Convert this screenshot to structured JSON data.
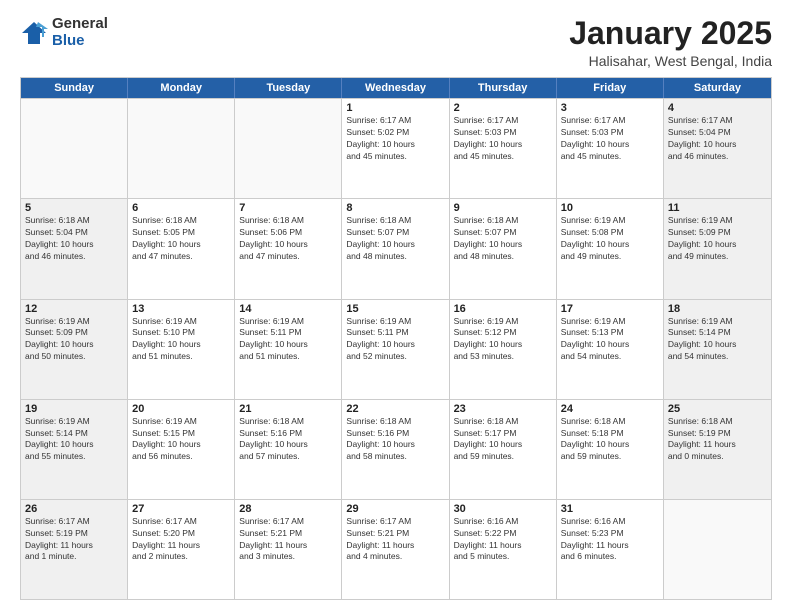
{
  "header": {
    "logo_general": "General",
    "logo_blue": "Blue",
    "month_title": "January 2025",
    "subtitle": "Halisahar, West Bengal, India"
  },
  "weekdays": [
    "Sunday",
    "Monday",
    "Tuesday",
    "Wednesday",
    "Thursday",
    "Friday",
    "Saturday"
  ],
  "weeks": [
    [
      {
        "day": "",
        "info": "",
        "empty": true
      },
      {
        "day": "",
        "info": "",
        "empty": true
      },
      {
        "day": "",
        "info": "",
        "empty": true
      },
      {
        "day": "1",
        "info": "Sunrise: 6:17 AM\nSunset: 5:02 PM\nDaylight: 10 hours\nand 45 minutes."
      },
      {
        "day": "2",
        "info": "Sunrise: 6:17 AM\nSunset: 5:03 PM\nDaylight: 10 hours\nand 45 minutes."
      },
      {
        "day": "3",
        "info": "Sunrise: 6:17 AM\nSunset: 5:03 PM\nDaylight: 10 hours\nand 45 minutes."
      },
      {
        "day": "4",
        "info": "Sunrise: 6:17 AM\nSunset: 5:04 PM\nDaylight: 10 hours\nand 46 minutes."
      }
    ],
    [
      {
        "day": "5",
        "info": "Sunrise: 6:18 AM\nSunset: 5:04 PM\nDaylight: 10 hours\nand 46 minutes."
      },
      {
        "day": "6",
        "info": "Sunrise: 6:18 AM\nSunset: 5:05 PM\nDaylight: 10 hours\nand 47 minutes."
      },
      {
        "day": "7",
        "info": "Sunrise: 6:18 AM\nSunset: 5:06 PM\nDaylight: 10 hours\nand 47 minutes."
      },
      {
        "day": "8",
        "info": "Sunrise: 6:18 AM\nSunset: 5:07 PM\nDaylight: 10 hours\nand 48 minutes."
      },
      {
        "day": "9",
        "info": "Sunrise: 6:18 AM\nSunset: 5:07 PM\nDaylight: 10 hours\nand 48 minutes."
      },
      {
        "day": "10",
        "info": "Sunrise: 6:19 AM\nSunset: 5:08 PM\nDaylight: 10 hours\nand 49 minutes."
      },
      {
        "day": "11",
        "info": "Sunrise: 6:19 AM\nSunset: 5:09 PM\nDaylight: 10 hours\nand 49 minutes."
      }
    ],
    [
      {
        "day": "12",
        "info": "Sunrise: 6:19 AM\nSunset: 5:09 PM\nDaylight: 10 hours\nand 50 minutes."
      },
      {
        "day": "13",
        "info": "Sunrise: 6:19 AM\nSunset: 5:10 PM\nDaylight: 10 hours\nand 51 minutes."
      },
      {
        "day": "14",
        "info": "Sunrise: 6:19 AM\nSunset: 5:11 PM\nDaylight: 10 hours\nand 51 minutes."
      },
      {
        "day": "15",
        "info": "Sunrise: 6:19 AM\nSunset: 5:11 PM\nDaylight: 10 hours\nand 52 minutes."
      },
      {
        "day": "16",
        "info": "Sunrise: 6:19 AM\nSunset: 5:12 PM\nDaylight: 10 hours\nand 53 minutes."
      },
      {
        "day": "17",
        "info": "Sunrise: 6:19 AM\nSunset: 5:13 PM\nDaylight: 10 hours\nand 54 minutes."
      },
      {
        "day": "18",
        "info": "Sunrise: 6:19 AM\nSunset: 5:14 PM\nDaylight: 10 hours\nand 54 minutes."
      }
    ],
    [
      {
        "day": "19",
        "info": "Sunrise: 6:19 AM\nSunset: 5:14 PM\nDaylight: 10 hours\nand 55 minutes."
      },
      {
        "day": "20",
        "info": "Sunrise: 6:19 AM\nSunset: 5:15 PM\nDaylight: 10 hours\nand 56 minutes."
      },
      {
        "day": "21",
        "info": "Sunrise: 6:18 AM\nSunset: 5:16 PM\nDaylight: 10 hours\nand 57 minutes."
      },
      {
        "day": "22",
        "info": "Sunrise: 6:18 AM\nSunset: 5:16 PM\nDaylight: 10 hours\nand 58 minutes."
      },
      {
        "day": "23",
        "info": "Sunrise: 6:18 AM\nSunset: 5:17 PM\nDaylight: 10 hours\nand 59 minutes."
      },
      {
        "day": "24",
        "info": "Sunrise: 6:18 AM\nSunset: 5:18 PM\nDaylight: 10 hours\nand 59 minutes."
      },
      {
        "day": "25",
        "info": "Sunrise: 6:18 AM\nSunset: 5:19 PM\nDaylight: 11 hours\nand 0 minutes."
      }
    ],
    [
      {
        "day": "26",
        "info": "Sunrise: 6:17 AM\nSunset: 5:19 PM\nDaylight: 11 hours\nand 1 minute."
      },
      {
        "day": "27",
        "info": "Sunrise: 6:17 AM\nSunset: 5:20 PM\nDaylight: 11 hours\nand 2 minutes."
      },
      {
        "day": "28",
        "info": "Sunrise: 6:17 AM\nSunset: 5:21 PM\nDaylight: 11 hours\nand 3 minutes."
      },
      {
        "day": "29",
        "info": "Sunrise: 6:17 AM\nSunset: 5:21 PM\nDaylight: 11 hours\nand 4 minutes."
      },
      {
        "day": "30",
        "info": "Sunrise: 6:16 AM\nSunset: 5:22 PM\nDaylight: 11 hours\nand 5 minutes."
      },
      {
        "day": "31",
        "info": "Sunrise: 6:16 AM\nSunset: 5:23 PM\nDaylight: 11 hours\nand 6 minutes."
      },
      {
        "day": "",
        "info": "",
        "empty": true
      }
    ]
  ]
}
